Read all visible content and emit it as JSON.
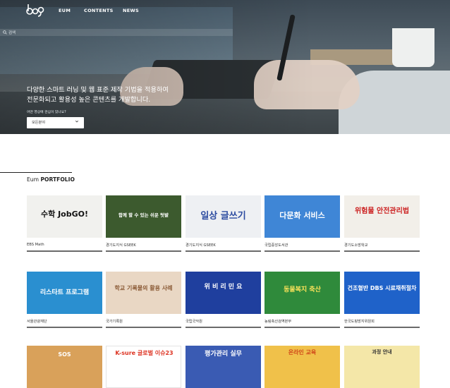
{
  "nav": {
    "items": [
      "EUM",
      "CONTENTS",
      "NEWS"
    ]
  },
  "search": {
    "label": "검색"
  },
  "hero": {
    "headline_line1": "다양한 스마트 러닝 및 웹 표준 제작 기법을 적용하여",
    "headline_line2": "전문화되고 활용성 높은 콘텐츠를 개발합니다.",
    "question": "어떤 영상에 관심이 있나요?",
    "select_value": "모든분야"
  },
  "section": {
    "title_prefix": "Eum ",
    "title_bold": "PORTFOLIO"
  },
  "portfolio": [
    {
      "caption": "EBS Math",
      "thumb_text": "수학 JobGO!",
      "bg": "#f1f1ee"
    },
    {
      "caption": "경기도지식 GSEEK",
      "thumb_text": "함께 할 수 있는 쉬운 텃밭",
      "bg": "#3c5a2e"
    },
    {
      "caption": "경기도지식 GSEEK",
      "thumb_text": "일상 글쓰기",
      "bg": "#eef0f3"
    },
    {
      "caption": "국립중앙도서관",
      "thumb_text": "다문화 서비스",
      "bg": "#3f86d6"
    },
    {
      "caption": "경기도소방학교",
      "thumb_text": "위험물 안전관리법",
      "bg": "#f2efe9"
    },
    {
      "caption": "서울관광재단",
      "thumb_text": "리스타트 프로그램",
      "bg": "#2a8fd0"
    },
    {
      "caption": "국가기록원",
      "thumb_text": "학교 기록물의 활용 사례",
      "bg": "#e9d7c4"
    },
    {
      "caption": "국립국악원",
      "thumb_text": "위 비 리 민 요",
      "bg": "#1f3f9e"
    },
    {
      "caption": "농림축산검역본부",
      "thumb_text": "동물복지 축산",
      "bg": "#2f8a3b"
    },
    {
      "caption": "한국도핑방지위원회",
      "thumb_text": "건조혈반 DBS 시료채취절차",
      "bg": "#1f62c9"
    },
    {
      "caption": "",
      "thumb_text": "SOS",
      "bg": "#d9a15a"
    },
    {
      "caption": "",
      "thumb_text": "K-sure 글로벌 이슈23",
      "bg": "#ffffff"
    },
    {
      "caption": "",
      "thumb_text": "평가관리 실무",
      "bg": "#3a5bb3"
    },
    {
      "caption": "",
      "thumb_text": "온라인 교육",
      "bg": "#f0c14a"
    },
    {
      "caption": "",
      "thumb_text": "과정 안내",
      "bg": "#f4e7a8"
    }
  ],
  "colors": {
    "accent": "#222222",
    "underline": "#6a6a6a"
  }
}
